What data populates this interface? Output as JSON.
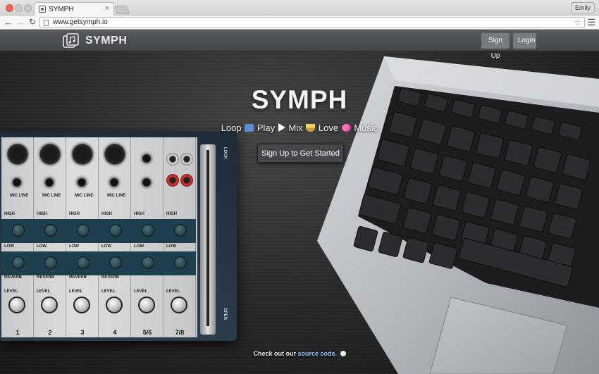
{
  "browser": {
    "tab_title": "SYMPH",
    "tab_close": "×",
    "profile_name": "Emily",
    "url": "www.getsymph.io",
    "icons": [
      "back-icon",
      "forward-icon",
      "reload-icon",
      "page-icon",
      "bookmark-star-icon",
      "menu-icon"
    ]
  },
  "site": {
    "brand": "SYMPH",
    "nav": {
      "signup_label": "Sign Up",
      "login_label": "Login"
    },
    "hero": {
      "title": "SYMPH",
      "tagline_words": [
        "Loop",
        "Play",
        "Mix",
        "Love",
        "Music"
      ],
      "cta_label": "Sign Up to Get Started"
    },
    "footer": {
      "prefix": "Check out our ",
      "link_text": "source code."
    },
    "mixer": {
      "channels": [
        "1",
        "2",
        "3",
        "4",
        "5/6",
        "7/8"
      ],
      "labels": {
        "mic_line": "MIC LINE",
        "high": "HIGH",
        "low": "LOW",
        "reverb": "REVERB",
        "level": "LEVEL",
        "lock": "LOCK",
        "open": "OPEN"
      }
    },
    "colors": {
      "nav_bg": "#4b4e52",
      "button_bg": "#777b80",
      "link": "#8fc3ff"
    }
  }
}
